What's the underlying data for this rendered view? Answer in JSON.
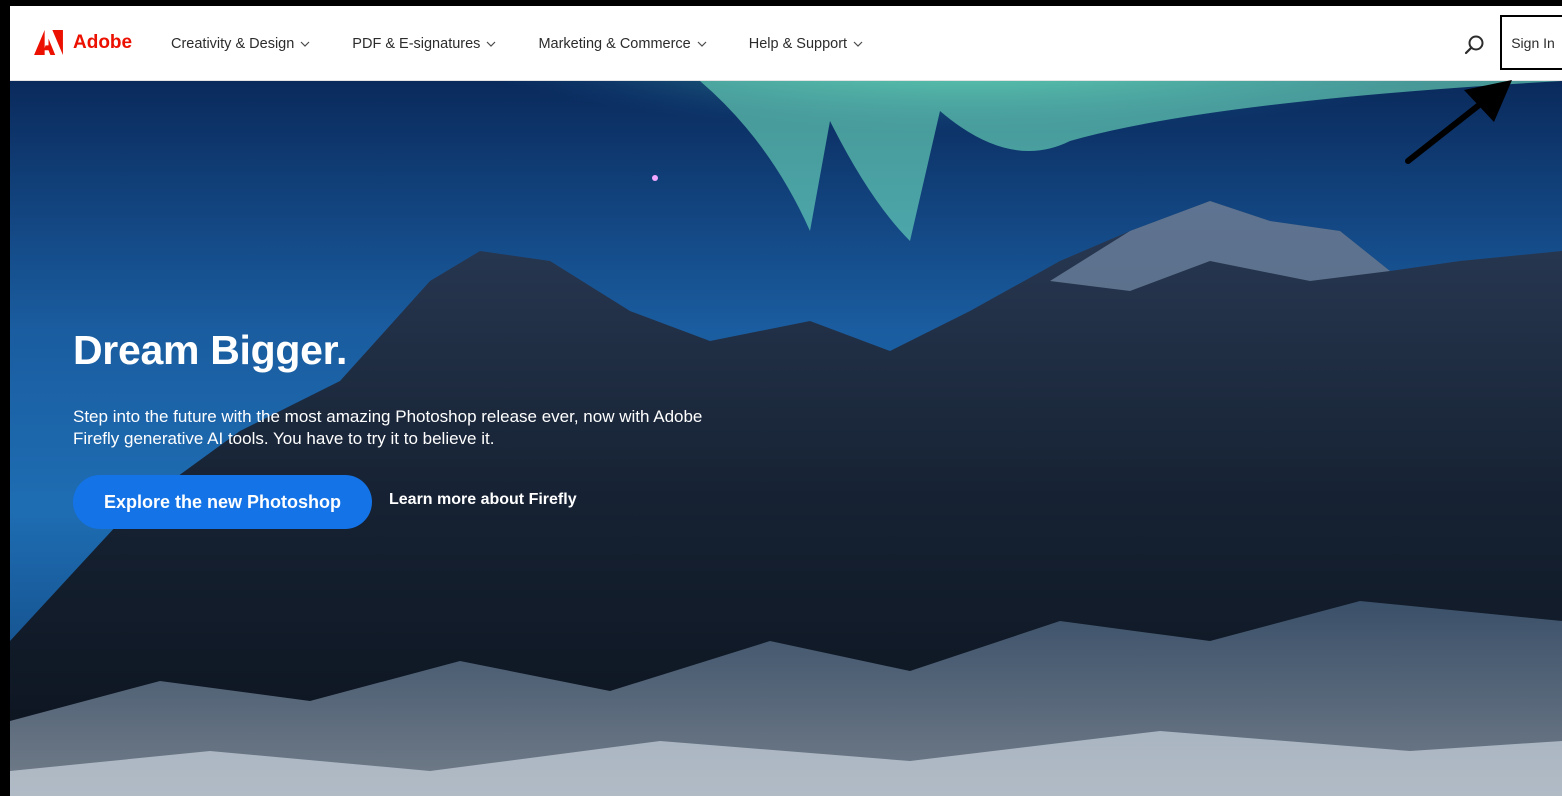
{
  "brand": {
    "name": "Adobe",
    "color": "#eb1000"
  },
  "nav": {
    "items": [
      {
        "label": "Creativity & Design"
      },
      {
        "label": "PDF & E-signatures"
      },
      {
        "label": "Marketing & Commerce"
      },
      {
        "label": "Help & Support"
      }
    ],
    "chevron_icon": "chevron-down-icon"
  },
  "header": {
    "search_icon": "search-icon",
    "signin_label": "Sign In"
  },
  "hero": {
    "title": "Dream Bigger.",
    "description": "Step into the future with the most amazing Photoshop release ever, now with Adobe Firefly generative AI tools. You have to try it to believe it.",
    "primary_cta": "Explore the new Photoshop",
    "secondary_cta": "Learn more about Firefly",
    "primary_color": "#1473e6",
    "image": "night sky with aurora over snowy mountains"
  },
  "annotation": {
    "arrow_icon": "pointer-arrow-icon"
  }
}
